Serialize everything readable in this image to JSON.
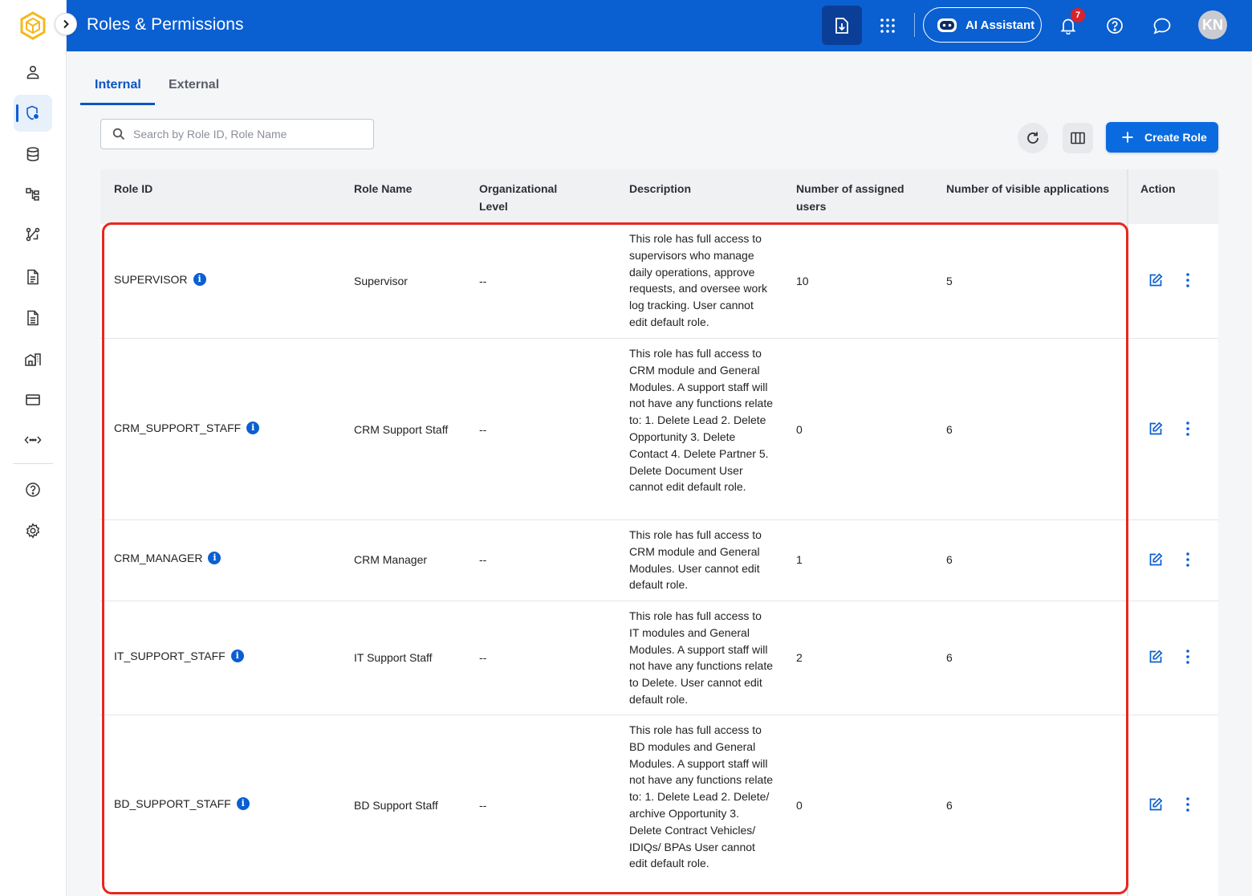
{
  "header": {
    "title": "Roles & Permissions",
    "ai_assistant_label": "AI Assistant",
    "notification_count": "7",
    "avatar_initials": "KN"
  },
  "sidebar": {
    "items": [
      {
        "icon": "user-icon"
      },
      {
        "icon": "role-shield-icon",
        "active": true
      },
      {
        "icon": "database-icon"
      },
      {
        "icon": "hierarchy-icon"
      },
      {
        "icon": "workflow-icon"
      },
      {
        "icon": "document-icon"
      },
      {
        "icon": "document-list-icon"
      },
      {
        "icon": "building-icon"
      },
      {
        "icon": "card-icon"
      },
      {
        "icon": "code-icon"
      },
      {
        "icon": "help-icon"
      },
      {
        "icon": "settings-icon"
      }
    ]
  },
  "tabs": [
    {
      "label": "Internal",
      "active": true
    },
    {
      "label": "External",
      "active": false
    }
  ],
  "toolbar": {
    "search_placeholder": "Search by Role ID, Role Name",
    "create_label": "Create Role"
  },
  "table": {
    "columns": [
      "Role ID",
      "Role Name",
      "Organizational Level",
      "Description",
      "Number of assigned users",
      "Number of visible applications",
      "Action"
    ],
    "rows": [
      {
        "role_id": "SUPERVISOR",
        "role_name": "Supervisor",
        "org_level": "--",
        "description": "This role has full access to supervisors who manage daily operations, approve requests, and oversee work log tracking. User cannot edit default role.",
        "assigned_users": "10",
        "visible_apps": "5"
      },
      {
        "role_id": "CRM_SUPPORT_STAFF",
        "role_name": "CRM Support Staff",
        "org_level": "--",
        "description": "This role has full access to CRM module and General Modules. A support staff will not have any functions relate to: 1. Delete Lead 2. Delete Opportunity 3. Delete Contact 4. Delete Partner 5. Delete Document User cannot edit default role.",
        "assigned_users": "0",
        "visible_apps": "6"
      },
      {
        "role_id": "CRM_MANAGER",
        "role_name": "CRM Manager",
        "org_level": "--",
        "description": "This role has full access to CRM module and General Modules. User cannot edit default role.",
        "assigned_users": "1",
        "visible_apps": "6"
      },
      {
        "role_id": "IT_SUPPORT_STAFF",
        "role_name": "IT Support Staff",
        "org_level": "--",
        "description": "This role has full access to IT modules and General Modules. A support staff will not have any functions relate to Delete. User cannot edit default role.",
        "assigned_users": "2",
        "visible_apps": "6"
      },
      {
        "role_id": "BD_SUPPORT_STAFF",
        "role_name": "BD Support Staff",
        "org_level": "--",
        "description": "This role has full access to BD modules and General Modules. A support staff will not have any functions relate to: 1. Delete Lead 2. Delete/ archive Opportunity 3. Delete Contract Vehicles/ IDIQs/ BPAs User cannot edit default role.",
        "assigned_users": "0",
        "visible_apps": "6"
      }
    ]
  },
  "colors": {
    "brand_blue": "#0a5fd1",
    "highlight_red": "#e8271e",
    "badge_red": "#d9222a"
  }
}
